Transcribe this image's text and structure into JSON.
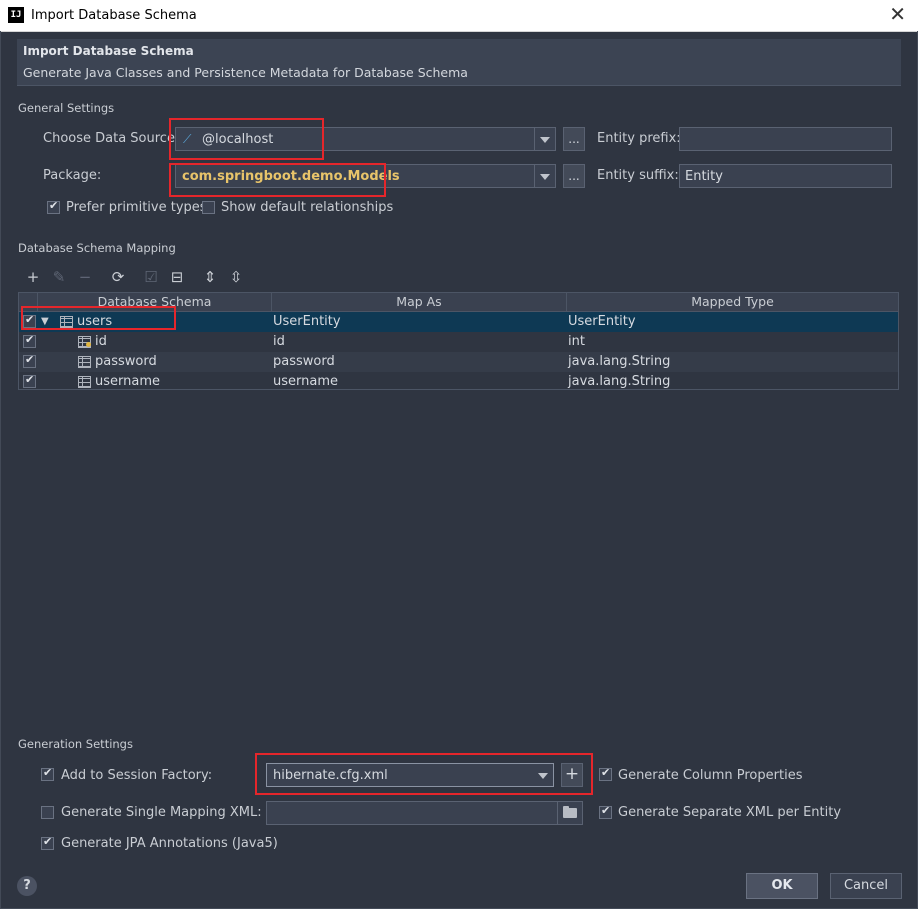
{
  "window": {
    "title": "Import Database Schema"
  },
  "banner": {
    "title": "Import Database Schema",
    "subtitle": "Generate Java Classes and Persistence Metadata for Database Schema"
  },
  "general": {
    "section": "General Settings",
    "data_source_label": "Choose Data Source:",
    "data_source_value": "@localhost",
    "entity_prefix_label": "Entity prefix:",
    "entity_prefix_value": "",
    "package_label": "Package:",
    "package_value": "com.springboot.demo.Models",
    "entity_suffix_label": "Entity suffix:",
    "entity_suffix_value": "Entity",
    "browse_label": "...",
    "prefer_primitive_label": "Prefer primitive types",
    "show_default_rel_label": "Show default relationships"
  },
  "mapping": {
    "section": "Database Schema Mapping",
    "columns": [
      "Database Schema",
      "Map As",
      "Mapped Type"
    ],
    "rows": [
      {
        "schema": "users",
        "map_as": "UserEntity",
        "type": "UserEntity"
      },
      {
        "schema": "id",
        "map_as": "id",
        "type": "int"
      },
      {
        "schema": "password",
        "map_as": "password",
        "type": "java.lang.String"
      },
      {
        "schema": "username",
        "map_as": "username",
        "type": "java.lang.String"
      }
    ]
  },
  "generation": {
    "section": "Generation Settings",
    "add_session_label": "Add to Session Factory:",
    "session_value": "hibernate.cfg.xml",
    "gen_column_props": "Generate Column Properties",
    "gen_single_xml": "Generate Single Mapping XML:",
    "gen_separate_xml": "Generate Separate XML per Entity",
    "gen_jpa": "Generate JPA Annotations (Java5)"
  },
  "buttons": {
    "ok": "OK",
    "cancel": "Cancel",
    "help": "?",
    "plus": "+"
  },
  "colors": {
    "highlight": "#e5262b",
    "selection": "#0e3954",
    "package_text": "#e8c46a"
  }
}
